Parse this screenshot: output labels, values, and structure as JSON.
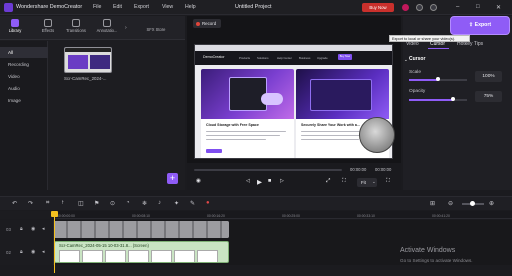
{
  "app": {
    "name": "Wondershare DemoCreator",
    "menu": [
      "File",
      "Edit",
      "Export",
      "View",
      "Help"
    ],
    "document_title": "Untitled Project",
    "buy_now": "Buy Now"
  },
  "library": {
    "tabs": [
      {
        "label": "Library"
      },
      {
        "label": "Effects"
      },
      {
        "label": "Transitions"
      },
      {
        "label": "Annotatio..."
      },
      {
        "label": "SFX Store"
      }
    ],
    "categories": [
      "All",
      "Recording",
      "Video",
      "Audio",
      "Image"
    ],
    "media_item_label": "Scr-CamRec_2024-...",
    "add_label": "+"
  },
  "preview": {
    "record_label": "Record",
    "site": {
      "logo": "DemoCreator",
      "nav": [
        "Products",
        "Solutions",
        "Help Center",
        "Business",
        "Upgrade"
      ],
      "cta": "Buy Now"
    },
    "cards": [
      {
        "title": "Cloud Storage with Free Space"
      },
      {
        "title": "Securely Share Your Work with a..."
      }
    ],
    "time_current": "00:00:00",
    "time_total": "00:00:00",
    "fit_label": "Fit"
  },
  "export": {
    "label": "Export",
    "tooltip": "Export to local or share your video(s)."
  },
  "properties": {
    "tabs": [
      "Video",
      "Cursor",
      "Hotkey Tips"
    ],
    "section": "Cursor",
    "scale_label": "Scale",
    "scale_value": "100%",
    "scale_level": 0.5,
    "opacity_label": "Opacity",
    "opacity_value": "75%",
    "opacity_level": 0.75
  },
  "timeline": {
    "ticks": [
      "00:00:00:00",
      "00:00:08:10",
      "00:00:16:20",
      "00:00:25:00",
      "00:00:33:10",
      "00:00:41:20"
    ],
    "tracks": [
      {
        "number": "03"
      },
      {
        "number": "02"
      }
    ],
    "screen_clip_label": "Scr-CamRec_2024-05-15 10-03-31.8... (Screen)"
  },
  "system": {
    "activate_title": "Activate Windows",
    "activate_sub": "Go to Settings to activate Windows."
  },
  "colors": {
    "accent": "#8f5cf6",
    "buy_now": "#c9302c",
    "playhead": "#f4c01f"
  }
}
